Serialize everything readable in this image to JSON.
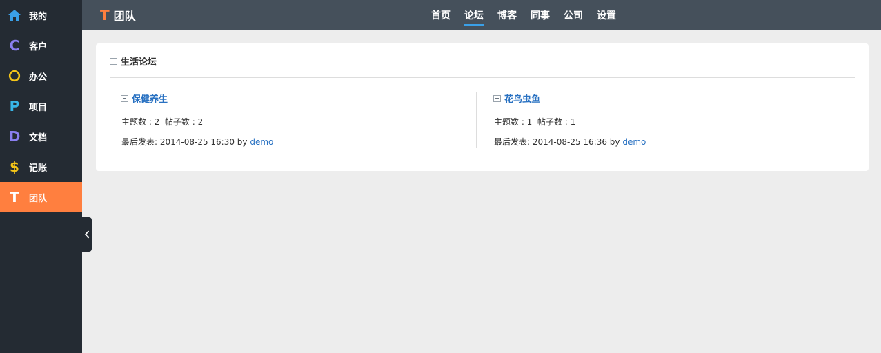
{
  "sidebar": {
    "items": [
      {
        "label": "我的",
        "icon": "home-icon",
        "glyph": "⌂",
        "color": "#3aa0e8",
        "active": false
      },
      {
        "label": "客户",
        "icon": "c-letter-icon",
        "glyph": "C",
        "color": "#8a7ff0",
        "active": false
      },
      {
        "label": "办公",
        "icon": "o-circle-icon",
        "glyph": "O",
        "color": "#f5c518",
        "active": false
      },
      {
        "label": "项目",
        "icon": "p-letter-icon",
        "glyph": "P",
        "color": "#38b6e8",
        "active": false
      },
      {
        "label": "文档",
        "icon": "d-letter-icon",
        "glyph": "D",
        "color": "#8a7ff0",
        "active": false
      },
      {
        "label": "记账",
        "icon": "dollar-icon",
        "glyph": "$",
        "color": "#f5c518",
        "active": false
      },
      {
        "label": "团队",
        "icon": "t-letter-icon",
        "glyph": "T",
        "color": "#ffffff",
        "active": true
      }
    ]
  },
  "header": {
    "brand_letter": "T",
    "title": "团队",
    "nav": [
      {
        "label": "首页",
        "active": false
      },
      {
        "label": "论坛",
        "active": true
      },
      {
        "label": "博客",
        "active": false
      },
      {
        "label": "同事",
        "active": false
      },
      {
        "label": "公司",
        "active": false
      },
      {
        "label": "设置",
        "active": false
      }
    ]
  },
  "section": {
    "title": "生活论坛",
    "forums": [
      {
        "name": "保健养生",
        "stats": "主题数 : 2  帖子数 : 2",
        "last_label": "最后发表: 2014-08-25 16:30 by ",
        "user": "demo"
      },
      {
        "name": "花鸟虫鱼",
        "stats": "主题数 : 1  帖子数 : 1",
        "last_label": "最后发表: 2014-08-25 16:36 by ",
        "user": "demo"
      }
    ]
  },
  "colors": {
    "accent": "#ff7f3f",
    "link": "#2a72c2",
    "nav_underline": "#3aa0e8"
  }
}
